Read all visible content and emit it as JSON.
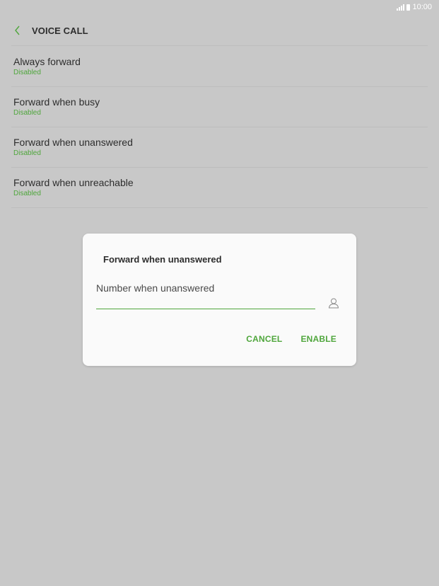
{
  "status_bar": {
    "time": "10:00",
    "signal_icon": "signal-icon",
    "battery_icon": "battery-icon"
  },
  "app_bar": {
    "back_icon": "chevron-left-icon",
    "title": "VOICE CALL"
  },
  "colors": {
    "accent": "#4fa63c",
    "background": "#c8c8c8",
    "dialog_bg": "#fafafa",
    "text": "#2d2d2d"
  },
  "settings": {
    "items": [
      {
        "title": "Always forward",
        "status": "Disabled"
      },
      {
        "title": "Forward when busy",
        "status": "Disabled"
      },
      {
        "title": "Forward when unanswered",
        "status": "Disabled"
      },
      {
        "title": "Forward when unreachable",
        "status": "Disabled"
      }
    ]
  },
  "dialog": {
    "title": "Forward when unanswered",
    "input_value": "",
    "input_placeholder": "Number when unanswered",
    "contact_icon": "contact-person-icon",
    "cancel_label": "CANCEL",
    "enable_label": "ENABLE"
  }
}
